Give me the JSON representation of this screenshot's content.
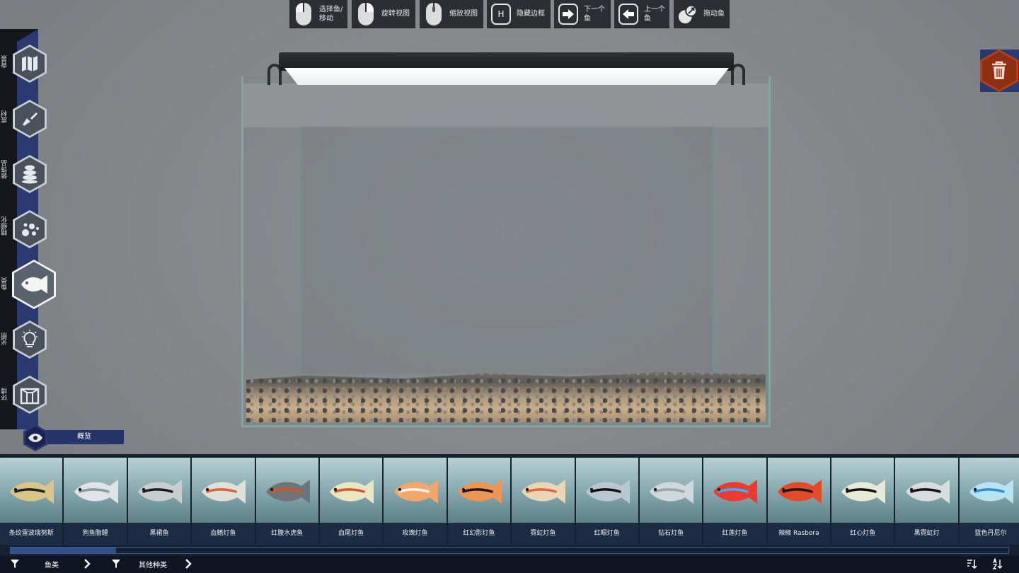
{
  "top_controls": [
    {
      "id": "select-move",
      "icon": "mouse-left-icon",
      "label": "选择鱼/移动"
    },
    {
      "id": "rotate-view",
      "icon": "mouse-right-icon",
      "label": "旋转视图"
    },
    {
      "id": "zoom-view",
      "icon": "mouse-scroll-icon",
      "label": "缩放视图"
    },
    {
      "id": "hide-border",
      "icon": "key-h-icon",
      "key": "H",
      "label": "隐藏边框"
    },
    {
      "id": "next-fish",
      "icon": "arrow-right-icon",
      "label": "下一个鱼"
    },
    {
      "id": "prev-fish",
      "icon": "arrow-left-icon",
      "label": "上一个鱼"
    },
    {
      "id": "drag-fish",
      "icon": "drag-icon",
      "label": "拖动鱼"
    }
  ],
  "sidebar": {
    "items": [
      {
        "label": "背景",
        "icon": "map-icon"
      },
      {
        "label": "底材",
        "icon": "shovel-icon"
      },
      {
        "label": "装饰品",
        "icon": "stones-icon"
      },
      {
        "label": "精细化",
        "icon": "bubbles-icon"
      },
      {
        "label": "鱼类",
        "icon": "fish-icon",
        "active": true
      },
      {
        "label": "光照",
        "icon": "lightbulb-icon"
      },
      {
        "label": "环境",
        "icon": "room-icon"
      }
    ],
    "overview_label": "概览"
  },
  "fish_list": [
    {
      "name": "条纹雷波瑞努斯",
      "color": "#d9c48a",
      "stripe": "#222222"
    },
    {
      "name": "狗鱼脂鲤",
      "color": "#dfe4e6",
      "stripe": "#8a9aa4"
    },
    {
      "name": "黑裙鱼",
      "color": "#c9cdcf",
      "stripe": "#1c1c1c"
    },
    {
      "name": "血鳍灯鱼",
      "color": "#dfe1d8",
      "stripe": "#d9603a"
    },
    {
      "name": "红腹水虎鱼",
      "color": "#6e7479",
      "stripe": "#d2581e"
    },
    {
      "name": "血尾灯鱼",
      "color": "#e7e7c4",
      "stripe": "#e0502c"
    },
    {
      "name": "玫瑰灯鱼",
      "color": "#f2a66a",
      "stripe": "#f6f6f6"
    },
    {
      "name": "红幻影灯鱼",
      "color": "#ef9452",
      "stripe": "#1a1a1a"
    },
    {
      "name": "霓虹灯鱼",
      "color": "#e9d5b8",
      "stripe": "#e2673a"
    },
    {
      "name": "红眼灯鱼",
      "color": "#b9c8d0",
      "stripe": "#111111"
    },
    {
      "name": "钻石灯鱼",
      "color": "#d0d8dc",
      "stripe": "#9aa6ae"
    },
    {
      "name": "红莲灯鱼",
      "color": "#ea3a32",
      "stripe": "#31b5ff"
    },
    {
      "name": "辣椒 Rasbora",
      "color": "#e24a28",
      "stripe": "#1a1a1a"
    },
    {
      "name": "红心灯鱼",
      "color": "#e8ead8",
      "stripe": "#101010"
    },
    {
      "name": "黑霓虹灯",
      "color": "#d8dcdc",
      "stripe": "#111111"
    },
    {
      "name": "蓝色丹尼尔",
      "color": "#b7e3f2",
      "stripe": "#2e8fd0"
    }
  ],
  "filters": [
    {
      "label": "鱼类",
      "icon": "funnel-icon"
    },
    {
      "label": "其他种类",
      "icon": "funnel-icon"
    }
  ],
  "scroll": {
    "position_fraction": 0.0,
    "visible_fraction": 0.1
  },
  "colors": {
    "panel_dark": "#2b2e33",
    "sidebar_blue": "#2a3a70",
    "delete_orange": "#b6401a",
    "card_label_bg": "#1b2c44"
  }
}
